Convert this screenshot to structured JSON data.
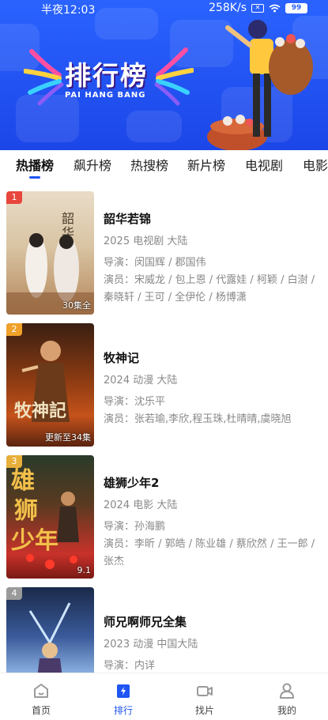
{
  "status_bar": {
    "time": "半夜12:03",
    "speed": "258K/s",
    "battery": "99"
  },
  "banner": {
    "title": "排行榜",
    "subtitle": "PAI HANG BANG"
  },
  "tabs": [
    {
      "label": "热播榜",
      "active": true
    },
    {
      "label": "飙升榜",
      "active": false
    },
    {
      "label": "热搜榜",
      "active": false
    },
    {
      "label": "新片榜",
      "active": false
    },
    {
      "label": "电视剧",
      "active": false
    },
    {
      "label": "电影",
      "active": false
    }
  ],
  "items": [
    {
      "rank": "1",
      "title": "韶华若锦",
      "meta": "2025 电视剧 大陆",
      "director": "导演：闵国辉 / 郡国伟",
      "cast": "演员：宋威龙 / 包上恩 / 代露娃 / 柯颖 / 白澍 / 秦晓轩 / 王可 / 全伊伦 / 杨博潇",
      "badge": "30集全",
      "rank_color": "#e8453c"
    },
    {
      "rank": "2",
      "title": "牧神记",
      "meta": "2024 动漫 大陆",
      "director": "导演：沈乐平",
      "cast": "演员：张若瑜,李欣,程玉珠,杜晴晴,虞晓旭",
      "badge": "更新至34集",
      "rank_color": "#f0a12a"
    },
    {
      "rank": "3",
      "title": "雄狮少年2",
      "meta": "2024 电影 大陆",
      "director": "导演：孙海鹏",
      "cast": "演员：李昕 / 郭皓 / 陈业雄 / 蔡欣然 / 王一郎 / 张杰",
      "badge": "9.1",
      "rank_color": "#e8b03a"
    },
    {
      "rank": "4",
      "title": "师兄啊师兄全集",
      "meta": "2023 动漫 中国大陆",
      "director": "导演：内详",
      "cast": "",
      "badge": "",
      "rank_color": "#9a9a9a"
    }
  ],
  "bottom_nav": [
    {
      "label": "首页",
      "icon": "home-icon",
      "active": false
    },
    {
      "label": "排行",
      "icon": "ranking-icon",
      "active": true
    },
    {
      "label": "找片",
      "icon": "video-camera-icon",
      "active": false
    },
    {
      "label": "我的",
      "icon": "user-icon",
      "active": false
    }
  ],
  "colors": {
    "accent": "#1f55f3",
    "banner": "#2a63ff"
  }
}
